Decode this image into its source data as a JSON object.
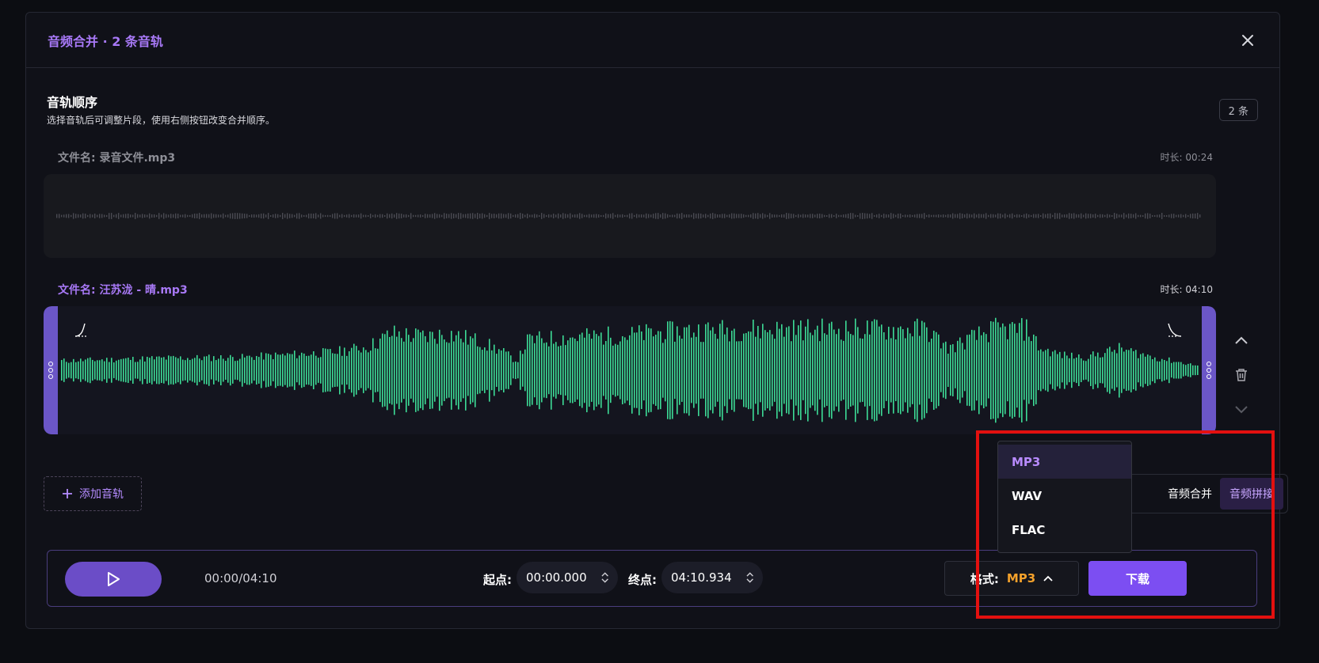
{
  "modal": {
    "title": "音频合并 · 2 条音轨",
    "close_icon": "close-icon"
  },
  "order": {
    "title": "音轨顺序",
    "desc": "选择音轨后可调整片段，使用右侧按钮改变合并顺序。",
    "count": "2 条"
  },
  "tracks": [
    {
      "name": "文件名: 录音文件.mp3",
      "duration": "时长: 00:24",
      "color": "#4a4b53"
    },
    {
      "name": "文件名: 汪苏泷 - 晴.mp3",
      "duration": "时长: 04:10",
      "color": "#3ddc97"
    }
  ],
  "add_track": {
    "label": "添加音轨",
    "icon": "plus-icon"
  },
  "mode": {
    "options": [
      "音频合并",
      "音频拼接"
    ],
    "active": "音频拼接"
  },
  "player": {
    "time": "00:00/04:10",
    "start_label": "起点:",
    "start_value": "00:00.000",
    "end_label": "终点:",
    "end_value": "04:10.934",
    "format_label": "格式:",
    "format_value": "MP3",
    "download": "下载"
  },
  "format_menu": {
    "items": [
      "MP3",
      "WAV",
      "FLAC"
    ],
    "selected": "MP3"
  },
  "colors": {
    "accent": "#7c4ef2",
    "waveform": "#3ddc97",
    "highlight": "#e3100f"
  }
}
